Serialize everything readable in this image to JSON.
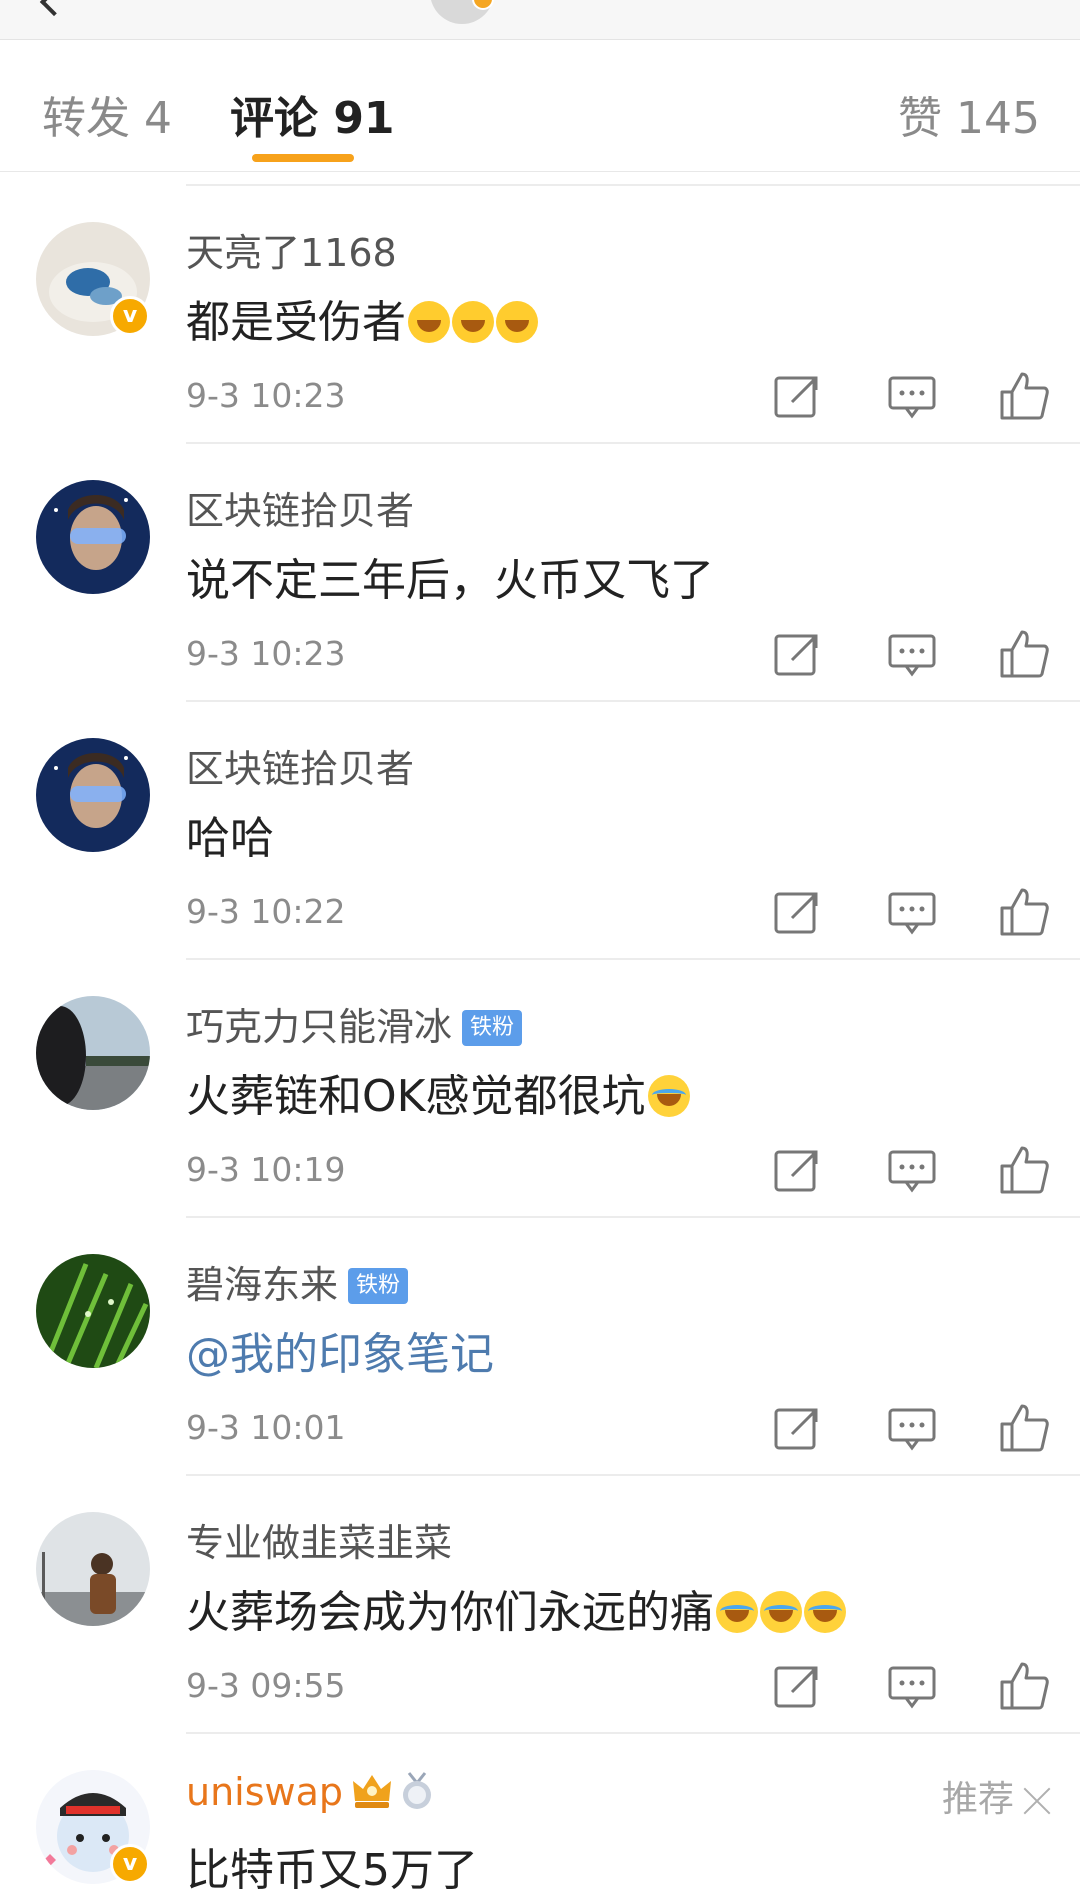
{
  "tabs": {
    "repost": "转发 4",
    "comment": "评论 91",
    "like": "赞 145"
  },
  "comments": [
    {
      "name": "天亮了1168",
      "text": "都是受伤者",
      "emoji": [
        "laugh-cry",
        "laugh-cry",
        "laugh-cry"
      ],
      "time": "9-3 10:23",
      "verified": true
    },
    {
      "name": "区块链拾贝者",
      "text": "说不定三年后，火币又飞了",
      "time": "9-3 10:23"
    },
    {
      "name": "区块链拾贝者",
      "text": "哈哈",
      "time": "9-3 10:22"
    },
    {
      "name": "巧克力只能滑冰",
      "badge": "铁粉",
      "text": "火葬链和OK感觉都很坑",
      "emoji": [
        "crying"
      ],
      "time": "9-3 10:19"
    },
    {
      "name": "碧海东来",
      "badge": "铁粉",
      "text": "@我的印象笔记",
      "time": "9-3 10:01"
    },
    {
      "name": "专业做韭菜韭菜",
      "text": "火葬场会成为你们永远的痛",
      "emoji": [
        "crying",
        "crying",
        "crying"
      ],
      "time": "9-3 09:55"
    },
    {
      "name": "uniswap",
      "text": "比特币又5万了",
      "verified": true,
      "recommend": "推荐"
    }
  ],
  "colors": {
    "accent": "#f7a21b",
    "mention": "#4e7bae",
    "fan_badge": "#5c9dea",
    "vip_name": "#e8761b"
  }
}
